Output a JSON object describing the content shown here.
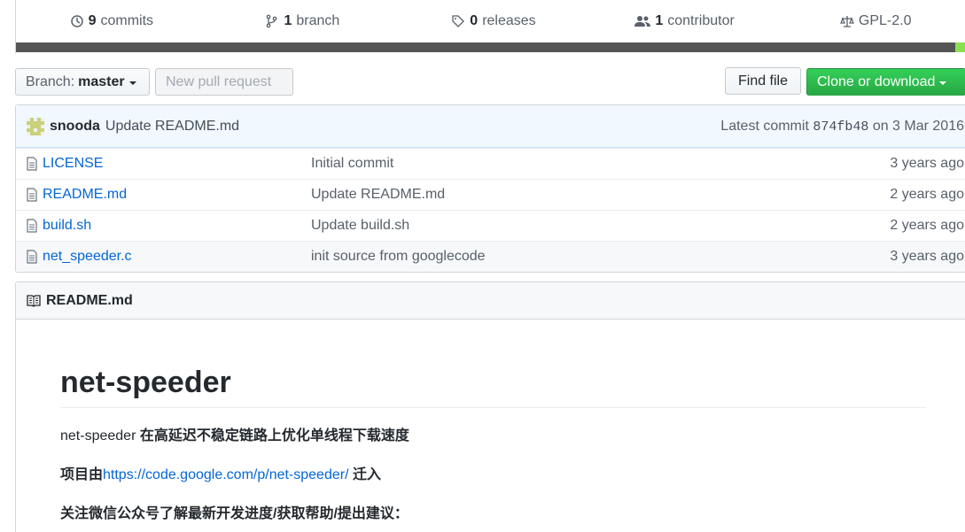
{
  "summary": {
    "commits_count": "9",
    "commits_label": "commits",
    "branch_count": "1",
    "branch_label": "branch",
    "releases_count": "0",
    "releases_label": "releases",
    "contributor_count": "1",
    "contributor_label": "contributor",
    "license": "GPL-2.0"
  },
  "language_colors": {
    "primary": "#555555",
    "secondary": "#89e051"
  },
  "toolbar": {
    "branch_prefix": "Branch:",
    "branch_name": "master",
    "new_pr_label": "New pull request",
    "find_file_label": "Find file",
    "clone_label": "Clone or download"
  },
  "commit": {
    "author": "snooda",
    "message": "Update README.md",
    "latest_prefix": "Latest commit",
    "sha": "874fb48",
    "date": "on 3 Mar 2016"
  },
  "files": [
    {
      "name": "LICENSE",
      "message": "Initial commit",
      "age": "3 years ago"
    },
    {
      "name": "README.md",
      "message": "Update README.md",
      "age": "2 years ago"
    },
    {
      "name": "build.sh",
      "message": "Update build.sh",
      "age": "2 years ago"
    },
    {
      "name": "net_speeder.c",
      "message": "init source from googlecode",
      "age": "3 years ago"
    }
  ],
  "readme": {
    "filename": "README.md",
    "title": "net-speeder",
    "p1_plain": "net-speeder ",
    "p1_bold": "在高延迟不稳定链路上优化单线程下载速度",
    "p2_prefix": "项目由",
    "p2_link": "https://code.google.com/p/net-speeder/",
    "p2_suffix": " 迁入",
    "p3": "关注微信公众号了解最新开发进度/获取帮助/提出建议："
  }
}
